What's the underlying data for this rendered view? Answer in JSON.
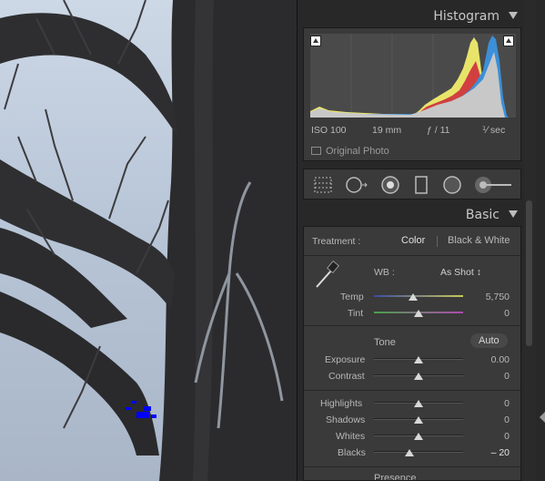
{
  "histogram": {
    "title": "Histogram",
    "iso": "ISO 100",
    "focal": "19 mm",
    "aperture": "ƒ / 11",
    "shutter": "⅟ sec",
    "original_photo_label": "Original Photo"
  },
  "tools": [
    "crop-overlay",
    "spot-removal",
    "red-eye",
    "graduated-filter",
    "radial-filter",
    "adjustment-brush"
  ],
  "basic": {
    "title": "Basic",
    "treatment_label": "Treatment :",
    "treatment_color": "Color",
    "treatment_bw": "Black & White",
    "wb_label": "WB :",
    "wb_value": "As Shot ↕",
    "temp_label": "Temp",
    "temp_value": "5,750",
    "tint_label": "Tint",
    "tint_value": "0",
    "tone_label": "Tone",
    "auto_label": "Auto",
    "exposure_label": "Exposure",
    "exposure_value": "0.00",
    "contrast_label": "Contrast",
    "contrast_value": "0",
    "highlights_label": "Highlights",
    "highlights_value": "0",
    "shadows_label": "Shadows",
    "shadows_value": "0",
    "whites_label": "Whites",
    "whites_value": "0",
    "blacks_label": "Blacks",
    "blacks_value": "– 20",
    "presence_label": "Presence"
  },
  "slider_levels": {
    "temp": 0.44,
    "tint": 0.5,
    "exposure": 0.5,
    "contrast": 0.5,
    "highlights": 0.5,
    "shadows": 0.5,
    "whites": 0.5,
    "blacks": 0.4
  },
  "colors": {
    "panel_bg": "#282828",
    "section_bg": "#3a3a3a",
    "text": "#b8b8b8",
    "clip_blue": "#0000ff"
  }
}
